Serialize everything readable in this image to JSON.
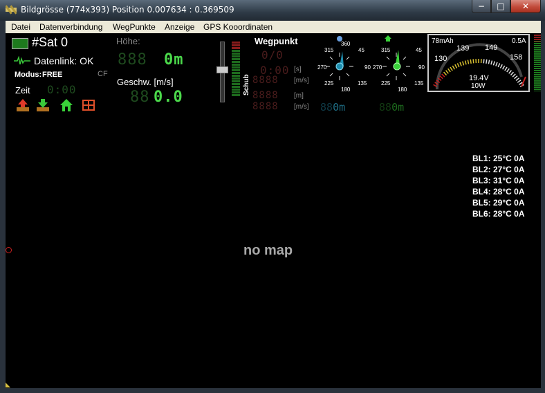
{
  "window": {
    "title": "Bildgrösse (774x393) Position 0.007634 : 0.369509",
    "min": "−",
    "max": "□",
    "close": "✕"
  },
  "menu": [
    "Datei",
    "Datenverbindung",
    "WegPunkte",
    "Anzeige",
    "GPS Kooordinaten"
  ],
  "status": {
    "sat": "#Sat 0",
    "datenlink": "Datenlink: OK",
    "modus_label": "Modus:",
    "modus_value": "FREE",
    "cf": "CF",
    "zeit_label": "Zeit",
    "zeit_value": "0:00"
  },
  "altitude": {
    "label": "Höhe:",
    "value": "0m",
    "dim": "888"
  },
  "speed": {
    "label": "Geschw. [m/s]",
    "value": "0.0",
    "dim": "88"
  },
  "thrust": {
    "label": "Schub"
  },
  "waypoint": {
    "label": "Wegpunkt",
    "count": "0/0",
    "time": "0:00",
    "unit_s": "[s]",
    "unit_ms1": "[m/s]",
    "unit_m": "[m]",
    "unit_ms2": "[m/s]",
    "val_left": "0m",
    "val_right": "0m"
  },
  "compass_labels": [
    "360",
    "45",
    "90",
    "135",
    "180",
    "225",
    "270",
    "315"
  ],
  "gauge": {
    "mah": "78mAh",
    "amp": "0.5A",
    "t130": "130",
    "t139": "139",
    "t149": "149",
    "t158": "158",
    "voltage": "19.4V",
    "watt": "10W"
  },
  "bl": [
    "BL1: 25°C  0A",
    "BL2: 27°C  0A",
    "BL3: 31°C  0A",
    "BL4: 28°C  0A",
    "BL5: 29°C  0A",
    "BL6: 28°C  0A"
  ],
  "map": {
    "text": "no map"
  },
  "colors": {
    "accent_green": "#4bd94b",
    "led_off": "#1e4a1e",
    "red_led": "#4a1c1c",
    "cyan": "#1f8fb0",
    "bar_red": "#d02020"
  },
  "icons": [
    "upload-icon",
    "download-icon",
    "home-icon",
    "grid-icon",
    "satellite-icon",
    "heartbeat-icon"
  ]
}
